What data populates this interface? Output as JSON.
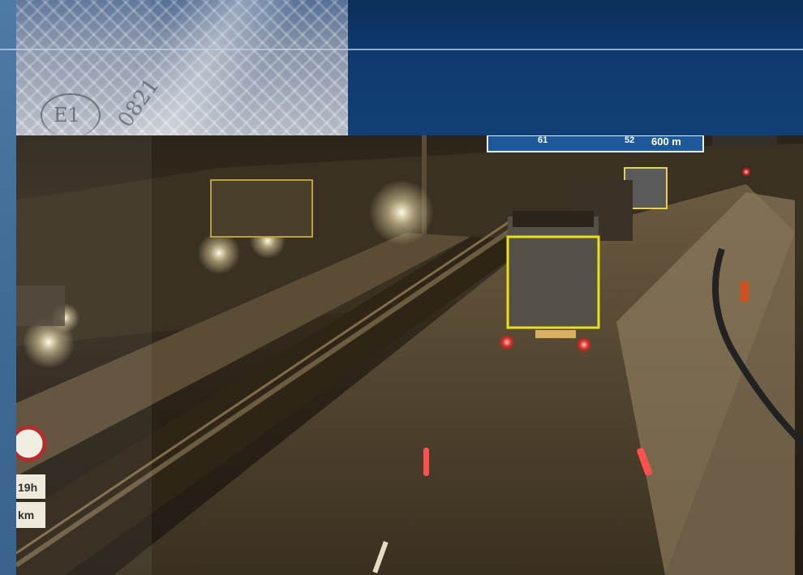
{
  "reflective_sheet": {
    "approval_mark": "E1",
    "serial": "0821"
  },
  "highway_sign": {
    "exit_left": "61",
    "exit_right": "52",
    "distance": "600 m"
  },
  "roadside_signs": {
    "time": "19h",
    "distance_unit": "km"
  },
  "colors": {
    "banner_blue": "#0f3a6f",
    "stripe_blue": "#3e6995"
  }
}
